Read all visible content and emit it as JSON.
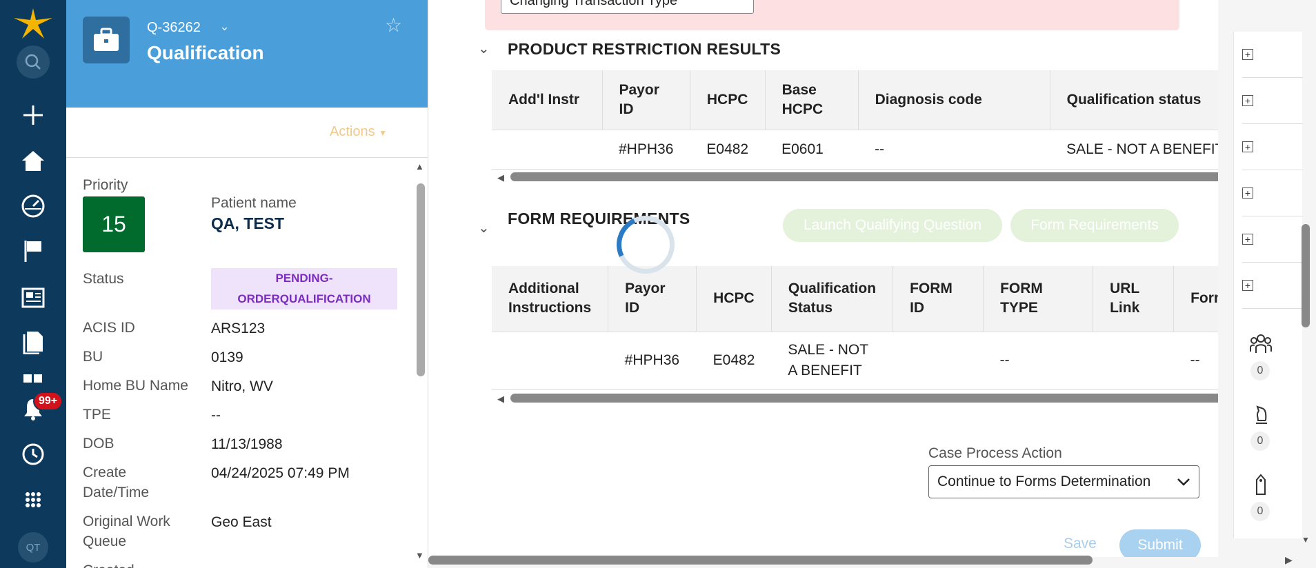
{
  "nav": {
    "notification_badge": "99+",
    "avatar_initials": "QT",
    "icons": [
      "star-logo-icon",
      "search-icon",
      "plus-icon",
      "home-icon",
      "dashboard-gauge-icon",
      "flag-icon",
      "news-icon",
      "documents-icon",
      "widgets-icon",
      "bell-icon",
      "history-icon",
      "apps-grid-icon"
    ]
  },
  "case": {
    "id": "Q-36262",
    "title": "Qualification",
    "actions_label": "Actions",
    "priority_label": "Priority",
    "priority_value": "15",
    "patient_name_label": "Patient name",
    "patient_name": "QA, TEST",
    "status_label": "Status",
    "status_value_line1": "PENDING-",
    "status_value_line2": "ORDERQUALIFICATION",
    "fields": [
      {
        "label": "ACIS ID",
        "value": "ARS123"
      },
      {
        "label": "BU",
        "value": "0139"
      },
      {
        "label": "Home BU Name",
        "value": "Nitro, WV"
      },
      {
        "label": "TPE",
        "value": "--"
      },
      {
        "label": "DOB",
        "value": "11/13/1988"
      }
    ],
    "create_label_1": "Create",
    "create_label_2": "Date/Time",
    "create_value": "04/24/2025 07:49 PM",
    "queue_label_1": "Original Work",
    "queue_label_2": "Queue",
    "queue_value": "Geo East",
    "created_label": "Created"
  },
  "main": {
    "alert_input_value": "Changing Transaction Type",
    "product_section_title": "PRODUCT RESTRICTION RESULTS",
    "product_table": {
      "headers": [
        "Add'l Instr",
        "Payor ID",
        "HCPC",
        "Base HCPC",
        "Diagnosis code",
        "Qualification status"
      ],
      "rows": [
        [
          "",
          "#HPH36",
          "E0482",
          "E0601",
          "--",
          "SALE - NOT A BENEFIT"
        ]
      ]
    },
    "forms_section_title": "FORM REQUIREMENTS",
    "launch_button": "Launch Qualifying Question",
    "form_req_button": "Form Requirements",
    "forms_table": {
      "headers": [
        "Additional Instructions",
        "Payor ID",
        "HCPC",
        "Qualification Status",
        "FORM ID",
        "FORM TYPE",
        "URL Link",
        "Form Pu"
      ],
      "rows": [
        [
          "",
          "#HPH36",
          "E0482",
          "SALE - NOT A BENEFIT",
          "",
          "--",
          "",
          "--"
        ]
      ]
    },
    "case_process_label": "Case Process Action",
    "case_process_value": "Continue to Forms Determination",
    "save_label": "Save",
    "submit_label": "Submit"
  },
  "rail": {
    "counts": [
      "0",
      "0",
      "0"
    ]
  }
}
